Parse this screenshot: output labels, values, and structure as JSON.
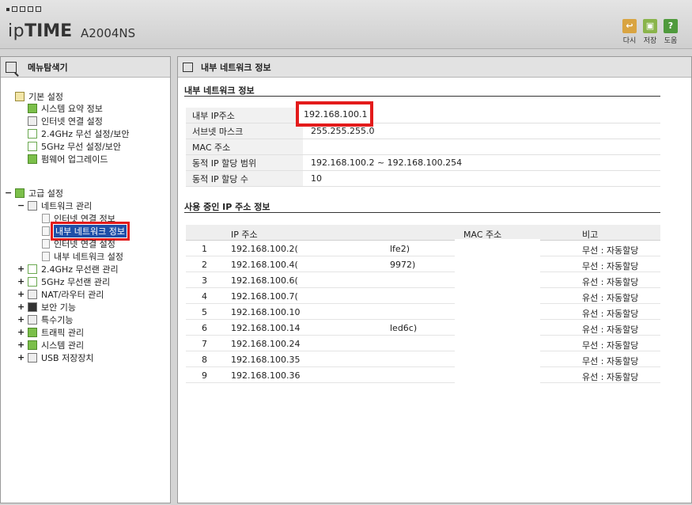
{
  "header": {
    "brand_prefix": "ip",
    "brand_bold": "TIME",
    "model": "A2004NS",
    "tools": [
      {
        "label": "다시",
        "icon": "refresh-icon",
        "color": "#d9a441",
        "glyph": "↩"
      },
      {
        "label": "저장",
        "icon": "save-icon",
        "color": "#8ab44a",
        "glyph": "▣"
      },
      {
        "label": "도움",
        "icon": "help-icon",
        "color": "#4f9a3c",
        "glyph": "?"
      }
    ]
  },
  "sidebar": {
    "title": "메뉴탐색기",
    "basic": {
      "label": "기본 설정",
      "items": [
        "시스템 요약 정보",
        "인터넷 연결 설정",
        "2.4GHz 무선 설정/보안",
        "5GHz 무선 설정/보안",
        "펌웨어 업그레이드"
      ]
    },
    "advanced": {
      "label": "고급 설정",
      "network": {
        "label": "네트워크 관리",
        "items": [
          "인터넷 연결 정보",
          "내부 네트워크 정보",
          "인터넷 연결 설정",
          "내부 네트워크 설정"
        ]
      },
      "groups": [
        "2.4GHz 무선랜 관리",
        "5GHz 무선랜 관리",
        "NAT/라우터 관리",
        "보안 기능",
        "특수기능",
        "트래픽 관리",
        "시스템 관리",
        "USB 저장장치"
      ]
    }
  },
  "main": {
    "title": "내부 네트워크 정보",
    "section1": "내부 네트워크 정보",
    "info": [
      {
        "label": "내부 IP주소",
        "value": "192.168.100.1"
      },
      {
        "label": "서브넷 마스크",
        "value": "255.255.255.0"
      },
      {
        "label": "MAC 주소",
        "value": ""
      },
      {
        "label": "동적 IP 할당 범위",
        "value": "192.168.100.2 ~  192.168.100.254"
      },
      {
        "label": "동적 IP 할당 수",
        "value": "10"
      }
    ],
    "section2": "사용 중인 IP 주소 정보",
    "table": {
      "headers": {
        "ip": "IP 주소",
        "mac": "MAC 주소",
        "note": "비고"
      },
      "rows": [
        {
          "num": "1",
          "ip": "192.168.100.2(",
          "tail": "lfe2)",
          "note": "무선 : 자동할당"
        },
        {
          "num": "2",
          "ip": "192.168.100.4(",
          "tail": "9972)",
          "note": "무선 : 자동할당"
        },
        {
          "num": "3",
          "ip": "192.168.100.6(",
          "tail": "",
          "note": "유선 : 자동할당"
        },
        {
          "num": "4",
          "ip": "192.168.100.7(",
          "tail": "",
          "note": "유선 : 자동할당"
        },
        {
          "num": "5",
          "ip": "192.168.100.10",
          "tail": "",
          "note": "유선 : 자동할당"
        },
        {
          "num": "6",
          "ip": "192.168.100.14",
          "tail": "led6c)",
          "note": "유선 : 자동할당"
        },
        {
          "num": "7",
          "ip": "192.168.100.24",
          "tail": "",
          "note": "무선 : 자동할당"
        },
        {
          "num": "8",
          "ip": "192.168.100.35",
          "tail": "",
          "note": "무선 : 자동할당"
        },
        {
          "num": "9",
          "ip": "192.168.100.36",
          "tail": "",
          "note": "유선 : 자동할당"
        }
      ]
    }
  }
}
